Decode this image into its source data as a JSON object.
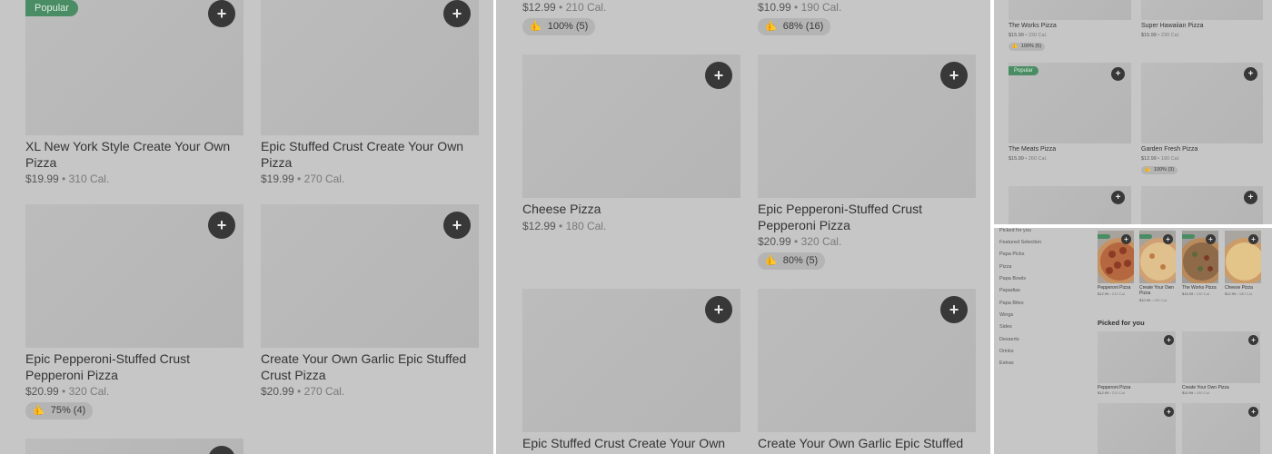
{
  "panel1": {
    "popular_badge": "Popular",
    "items": [
      {
        "name": "XL New York Style Create Your Own Pizza",
        "price": "$19.99",
        "cal": "310 Cal."
      },
      {
        "name": "Epic Stuffed Crust Create Your Own Pizza",
        "price": "$19.99",
        "cal": "270 Cal."
      },
      {
        "name": "Epic Pepperoni-Stuffed Crust Pepperoni Pizza",
        "price": "$20.99",
        "cal": "320 Cal.",
        "rating": "75% (4)"
      },
      {
        "name": "Create Your Own Garlic Epic Stuffed Crust Pizza",
        "price": "$20.99",
        "cal": "270 Cal."
      }
    ]
  },
  "panel2": {
    "top_items": [
      {
        "price": "$12.99",
        "cal": "210 Cal.",
        "rating": "100% (5)"
      },
      {
        "price": "$10.99",
        "cal": "190 Cal.",
        "rating": "68% (16)"
      }
    ],
    "items": [
      {
        "name": "Cheese Pizza",
        "price": "$12.99",
        "cal": "180 Cal."
      },
      {
        "name": "Epic Pepperoni-Stuffed Crust Pepperoni Pizza",
        "price": "$20.99",
        "cal": "320 Cal.",
        "rating": "80% (5)"
      },
      {
        "name": "Epic Stuffed Crust Create Your Own Pizza"
      },
      {
        "name": "Create Your Own Garlic Epic Stuffed Crust Pizza"
      }
    ]
  },
  "panel3": {
    "popular_badge": "Popular",
    "items": [
      {
        "name": "The Works Pizza",
        "price": "$15.99",
        "cal": "230 Cal.",
        "rating": "100% (5)"
      },
      {
        "name": "Super Hawaiian Pizza",
        "price": "$15.99",
        "cal": "230 Cal."
      },
      {
        "name": "The Meats Pizza",
        "price": "$15.99",
        "cal": "260 Cal."
      },
      {
        "name": "Garden Fresh Pizza",
        "price": "$12.99",
        "cal": "190 Cal.",
        "rating": "100% (3)"
      }
    ]
  },
  "panel4": {
    "sidebar": [
      "Picked for you",
      "Featured Selection",
      "Papa Picks",
      "Pizza",
      "Papa Bowls",
      "Papadias",
      "Papa Bites",
      "Wings",
      "Sides",
      "Desserts",
      "Drinks",
      "Extras"
    ],
    "featured": [
      {
        "name": "Pepperoni Pizza",
        "price": "$12.99",
        "cal": "210 Cal."
      },
      {
        "name": "Create Your Own Pizza",
        "price": "$10.99",
        "cal": "190 Cal."
      },
      {
        "name": "The Works Pizza",
        "price": "$15.99",
        "cal": "230 Cal."
      },
      {
        "name": "Cheese Pizza",
        "price": "$12.99",
        "cal": "180 Cal."
      }
    ],
    "picked_title": "Picked for you",
    "picked": [
      {
        "name": "Pepperoni Pizza",
        "price": "$12.99",
        "cal": "210 Cal."
      },
      {
        "name": "Create Your Own Pizza",
        "price": "$10.99",
        "cal": "190 Cal."
      }
    ]
  },
  "common": {
    "sep": "•",
    "add_symbol": "+",
    "thumb_symbol": "👍"
  },
  "colors": {
    "overlay": "#c6c6c6",
    "popular_badge": "#4a8d64",
    "add_button": "#383838"
  }
}
